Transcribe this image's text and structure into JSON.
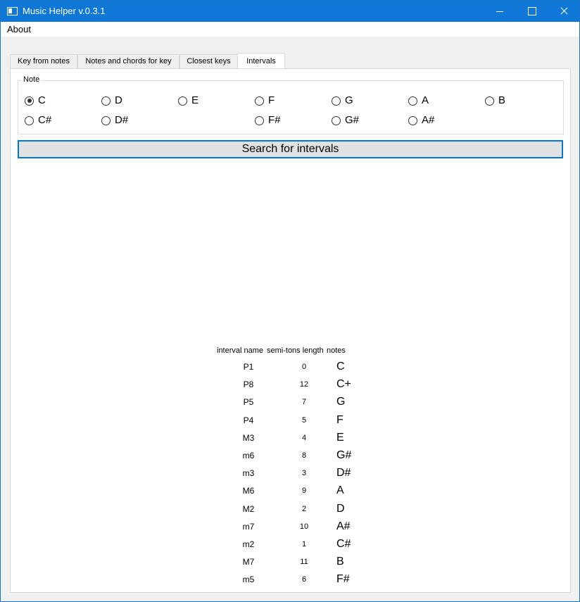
{
  "window": {
    "title": "Music Helper v.0.3.1"
  },
  "menu": {
    "about": "About"
  },
  "tabs": [
    {
      "label": "Key from notes"
    },
    {
      "label": "Notes and chords for key"
    },
    {
      "label": "Closest keys"
    },
    {
      "label": "Intervals"
    }
  ],
  "active_tab": "Intervals",
  "note_group": {
    "title": "Note",
    "selected": "C",
    "options": [
      {
        "label": "C",
        "checked": true
      },
      {
        "label": "D",
        "checked": false
      },
      {
        "label": "E",
        "checked": false
      },
      {
        "label": "F",
        "checked": false
      },
      {
        "label": "G",
        "checked": false
      },
      {
        "label": "A",
        "checked": false
      },
      {
        "label": "B",
        "checked": false
      },
      {
        "label": "C#",
        "checked": false
      },
      {
        "label": "D#",
        "checked": false
      },
      {
        "label": "F#",
        "checked": false
      },
      {
        "label": "G#",
        "checked": false
      },
      {
        "label": "A#",
        "checked": false
      }
    ]
  },
  "search_button": "Search for intervals",
  "results": {
    "headers": {
      "interval_name": "interval name",
      "semitones": "semi-tons length",
      "notes": "notes"
    },
    "rows": [
      {
        "name": "P1",
        "semitones": "0",
        "note": "C"
      },
      {
        "name": "P8",
        "semitones": "12",
        "note": "C+"
      },
      {
        "name": "P5",
        "semitones": "7",
        "note": "G"
      },
      {
        "name": "P4",
        "semitones": "5",
        "note": "F"
      },
      {
        "name": "M3",
        "semitones": "4",
        "note": "E"
      },
      {
        "name": "m6",
        "semitones": "8",
        "note": "G#"
      },
      {
        "name": "m3",
        "semitones": "3",
        "note": "D#"
      },
      {
        "name": "M6",
        "semitones": "9",
        "note": "A"
      },
      {
        "name": "M2",
        "semitones": "2",
        "note": "D"
      },
      {
        "name": "m7",
        "semitones": "10",
        "note": "A#"
      },
      {
        "name": "m2",
        "semitones": "1",
        "note": "C#"
      },
      {
        "name": "M7",
        "semitones": "11",
        "note": "B"
      },
      {
        "name": "m5",
        "semitones": "6",
        "note": "F#"
      }
    ]
  }
}
